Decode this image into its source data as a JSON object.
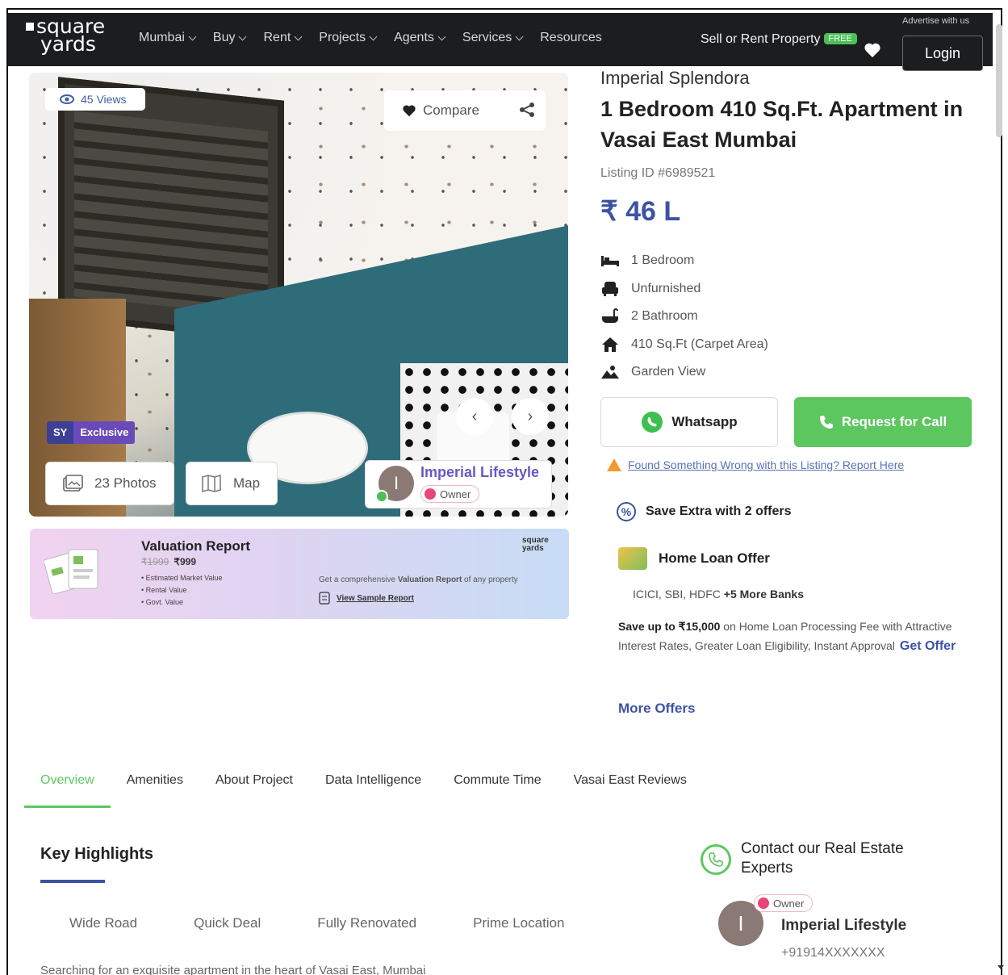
{
  "header": {
    "logo_line1": "square",
    "logo_line2": "yards",
    "nav": [
      {
        "label": "Mumbai"
      },
      {
        "label": "Buy"
      },
      {
        "label": "Rent"
      },
      {
        "label": "Projects"
      },
      {
        "label": "Agents"
      },
      {
        "label": "Services"
      },
      {
        "label": "Resources"
      }
    ],
    "sell_label": "Sell or Rent Property",
    "free_badge": "FREE",
    "advertise": "Advertise with us",
    "login_label": "Login"
  },
  "gallery": {
    "views": "45 Views",
    "compare_label": "Compare",
    "badge_sy": "SY",
    "badge_exclusive": "Exclusive",
    "photos_label": "23 Photos",
    "map_label": "Map",
    "prev": "‹",
    "next": "›",
    "owner_initial": "I",
    "owner_name": "Imperial Lifestyle",
    "owner_role": "Owner"
  },
  "valuation": {
    "title": "Valuation Report",
    "old_price": "₹1999",
    "price": "₹999",
    "items": [
      "Estimated Market Value",
      "Rental Value",
      "Govt. Value"
    ],
    "cta_prefix": "Get a comprehensive ",
    "cta_bold": "Valuation Report",
    "cta_suffix": " of any property",
    "sample_link": "View Sample Report",
    "brand": "square yards"
  },
  "listing": {
    "project_name": "Imperial Splendora",
    "title": "1 Bedroom 410 Sq.Ft. Apartment in Vasai East Mumbai",
    "listing_id": "Listing ID #6989521",
    "price": "₹ 46 L",
    "features": [
      {
        "icon": "bed-icon",
        "label": "1 Bedroom"
      },
      {
        "icon": "sofa-icon",
        "label": "Unfurnished"
      },
      {
        "icon": "bathtub-icon",
        "label": "2 Bathroom"
      },
      {
        "icon": "home-icon",
        "label": "410 Sq.Ft  (Carpet Area)"
      },
      {
        "icon": "landscape-icon",
        "label": "Garden View"
      }
    ],
    "whatsapp_label": "Whatsapp",
    "call_label": "Request for Call",
    "report_link": "Found Something Wrong with this Listing? Report Here"
  },
  "offers": {
    "save_extra": "Save Extra with 2 offers",
    "loan_title": "Home Loan Offer",
    "banks": "ICICI, SBI, HDFC",
    "banks_more": "+5 More Banks",
    "save_bold": "Save up to ₹15,000",
    "save_text": " on Home Loan Processing Fee with Attractive Interest Rates, Greater Loan Eligibility, Instant Approval",
    "get_offer": "Get Offer",
    "more_offers": "More Offers"
  },
  "tabs": [
    {
      "label": "Overview",
      "active": true
    },
    {
      "label": "Amenities"
    },
    {
      "label": "About Project"
    },
    {
      "label": "Data Intelligence"
    },
    {
      "label": "Commute Time"
    },
    {
      "label": "Vasai East Reviews"
    }
  ],
  "highlights": {
    "title": "Key Highlights",
    "tags": [
      "Wide Road",
      "Quick Deal",
      "Fully Renovated",
      "Prime Location"
    ],
    "description": "Searching for an exquisite apartment in the heart of Vasai East, Mumbai"
  },
  "contact": {
    "title": "Contact our Real Estate Experts",
    "role": "Owner",
    "initial": "I",
    "name": "Imperial Lifestyle",
    "phone": "+91914XXXXXXX"
  },
  "colors": {
    "accent_blue": "#3c53a3",
    "accent_green": "#5cc75f",
    "header_bg": "#1c1d1f"
  }
}
